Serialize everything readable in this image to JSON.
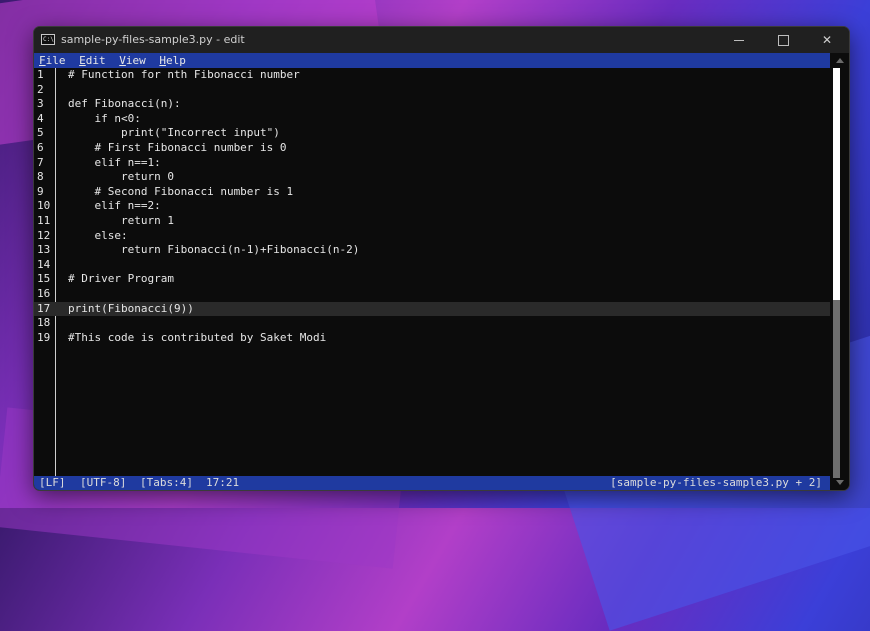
{
  "window": {
    "title": "sample-py-files-sample3.py - edit",
    "icon_text": "C:\\"
  },
  "menu": [
    "File",
    "Edit",
    "View",
    "Help"
  ],
  "editor": {
    "current_line": 17,
    "lines": [
      {
        "n": "1",
        "text": "# Function for nth Fibonacci number"
      },
      {
        "n": "2",
        "text": ""
      },
      {
        "n": "3",
        "text": "def Fibonacci(n):"
      },
      {
        "n": "4",
        "text": "    if n<0:"
      },
      {
        "n": "5",
        "text": "        print(\"Incorrect input\")"
      },
      {
        "n": "6",
        "text": "    # First Fibonacci number is 0"
      },
      {
        "n": "7",
        "text": "    elif n==1:"
      },
      {
        "n": "8",
        "text": "        return 0"
      },
      {
        "n": "9",
        "text": "    # Second Fibonacci number is 1"
      },
      {
        "n": "10",
        "text": "    elif n==2:"
      },
      {
        "n": "11",
        "text": "        return 1"
      },
      {
        "n": "12",
        "text": "    else:"
      },
      {
        "n": "13",
        "text": "        return Fibonacci(n-1)+Fibonacci(n-2)"
      },
      {
        "n": "14",
        "text": ""
      },
      {
        "n": "15",
        "text": "# Driver Program"
      },
      {
        "n": "16",
        "text": ""
      },
      {
        "n": "17",
        "text": "print(Fibonacci(9))"
      },
      {
        "n": "18",
        "text": ""
      },
      {
        "n": "19",
        "text": "#This code is contributed by Saket Modi"
      }
    ]
  },
  "status": {
    "line_ending": "[LF]",
    "encoding": "[UTF-8]",
    "tabs": "[Tabs:4]",
    "position": "17:21",
    "files": "[sample-py-files-sample3.py + 2]"
  }
}
